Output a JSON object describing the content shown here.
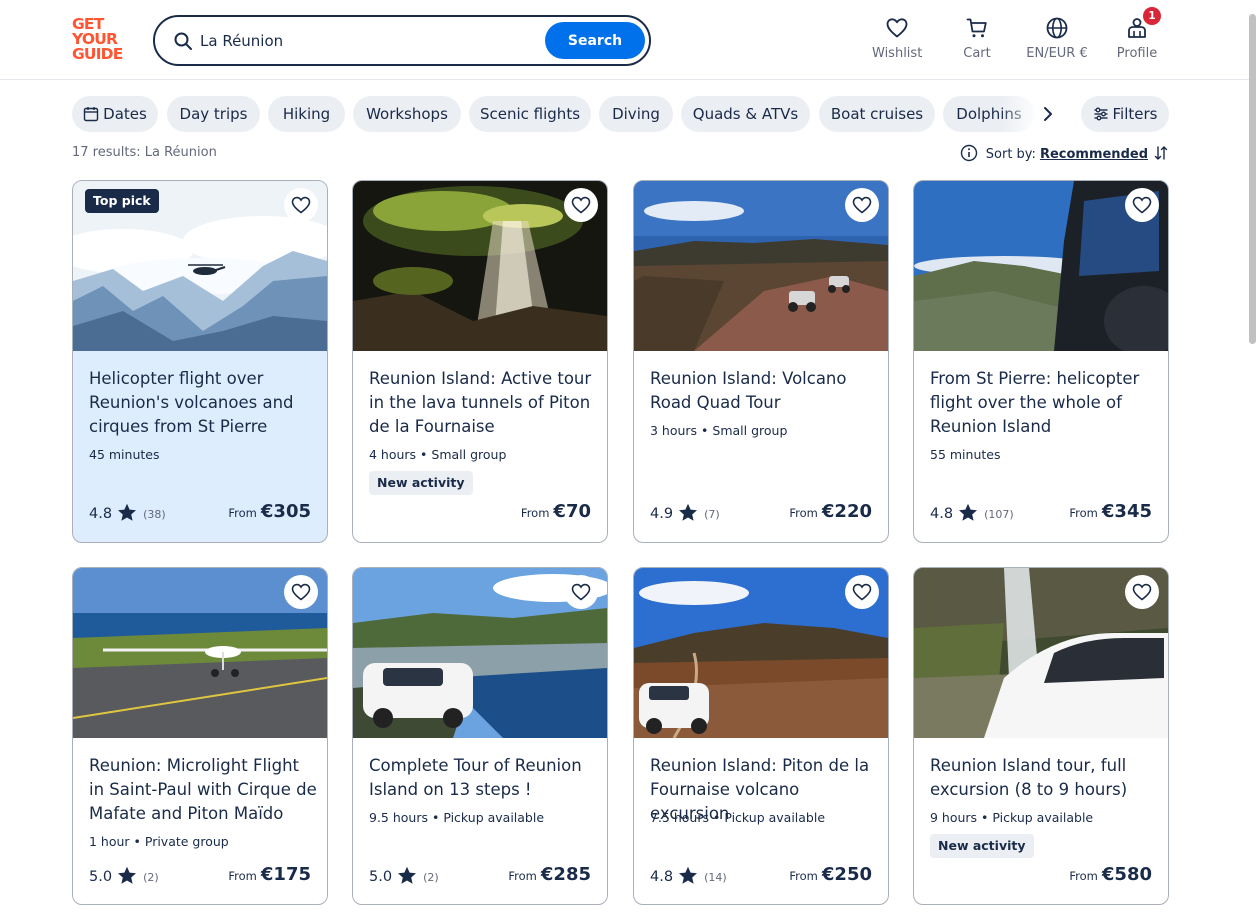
{
  "brand": {
    "line1": "GET",
    "line2": "YOUR",
    "line3": "GUIDE",
    "color": "#ff5533"
  },
  "search": {
    "value": "La Réunion",
    "button_label": "Search"
  },
  "nav": {
    "wishlist": "Wishlist",
    "cart": "Cart",
    "language": "EN/EUR €",
    "profile": "Profile",
    "profile_badge": "1"
  },
  "chips": [
    "Dates",
    "Day trips",
    "Hiking",
    "Workshops",
    "Scenic flights",
    "Diving",
    "Quads & ATVs",
    "Boat cruises",
    "Dolphins"
  ],
  "filters_label": "Filters",
  "results": {
    "count_text": "17 results: La Réunion"
  },
  "sort": {
    "label": "Sort by:",
    "value": "Recommended"
  },
  "cards": [
    {
      "badge": "Top pick",
      "title": "Helicopter flight over Reunion's volcanoes and cirques from St Pierre",
      "meta": "45 minutes",
      "rating": "4.8",
      "reviews": "(38)",
      "from": "From",
      "price": "€305"
    },
    {
      "title": "Reunion Island: Active tour in the lava tunnels of Piton de la Fournaise",
      "meta": "4 hours • Small group",
      "new_label": "New activity",
      "from": "From",
      "price": "€70"
    },
    {
      "title": "Reunion Island: Volcano Road Quad Tour",
      "meta": "3 hours • Small group",
      "rating": "4.9",
      "reviews": "(7)",
      "from": "From",
      "price": "€220"
    },
    {
      "title": "From St Pierre: helicopter flight over the whole of Reunion Island",
      "meta": "55 minutes",
      "rating": "4.8",
      "reviews": "(107)",
      "from": "From",
      "price": "€345"
    },
    {
      "title": "Reunion: Microlight Flight in Saint-Paul with Cirque de Mafate and Piton Maïdo",
      "meta": "1 hour • Private group",
      "rating": "5.0",
      "reviews": "(2)",
      "from": "From",
      "price": "€175"
    },
    {
      "title": "Complete Tour of Reunion Island on 13 steps !",
      "meta": "9.5 hours • Pickup available",
      "rating": "5.0",
      "reviews": "(2)",
      "from": "From",
      "price": "€285"
    },
    {
      "title": "Reunion Island: Piton de la Fournaise volcano excursion",
      "meta": "7.5 hours • Pickup available",
      "rating": "4.8",
      "reviews": "(14)",
      "from": "From",
      "price": "€250"
    },
    {
      "title": "Reunion Island tour, full excursion (8 to 9 hours)",
      "meta": "9 hours • Pickup available",
      "new_label": "New activity",
      "from": "From",
      "price": "€580"
    }
  ],
  "colors": {
    "accent": "#0071eb",
    "text": "#1a2b49",
    "highlight": "#ddedfd",
    "badge_red": "#d92638"
  }
}
